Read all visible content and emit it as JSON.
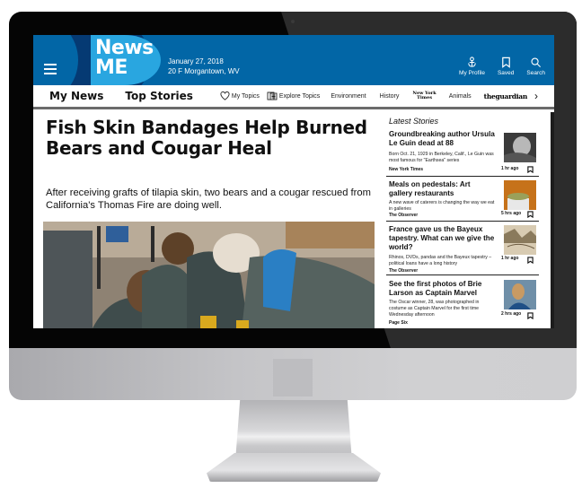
{
  "app": {
    "logo_line1": "News",
    "logo_line2": "ME",
    "date": "January 27, 2018",
    "weather_location": "20 F Morgantown, WV",
    "colors": {
      "primary": "#0266a6",
      "logo": "#29a6e0",
      "accent_dark": "#053a73"
    }
  },
  "top_actions": [
    {
      "label": "My Profile",
      "icon": "profile-icon"
    },
    {
      "label": "Saved",
      "icon": "bookmark-icon"
    },
    {
      "label": "Search",
      "icon": "search-icon"
    }
  ],
  "nav": {
    "primary": [
      "My News",
      "Top Stories"
    ],
    "my_topics": "My Topics",
    "explore_topics": "Explore Topics",
    "topics": [
      "Environment",
      "History"
    ],
    "nyt_line1": "New York",
    "nyt_line2": "Times",
    "animals": "Animals",
    "guardian": "theguardian",
    "next": "›"
  },
  "main_article": {
    "headline": "Fish Skin Bandages Help Burned Bears and Cougar Heal",
    "subhead": "After receiving grafts of tilapia skin, two bears and a cougar rescued from California's Thomas Fire are doing well."
  },
  "sidebar": {
    "title": "Latest Stories",
    "stories": [
      {
        "title": "Groundbreaking author Ursula Le Guin dead at 88",
        "description": "Born Oct. 21, 1929 in Berkeley, Calif., Le Guin was most famous for \"Earthsea\" series",
        "source": "New York Times",
        "time": "1 hr ago"
      },
      {
        "title": "Meals on pedestals: Art gallery restaurants",
        "description": "A new wave of caterers is changing the way we eat in galleries",
        "source": "The Observer",
        "time": "5 hrs ago"
      },
      {
        "title": "France gave us the Bayeux tapestry. What can we give the world?",
        "description": "Rhinos, DVDs, pandas and the Bayeux tapestry – political loans have a long history",
        "source": "The Observer",
        "time": "1 hr ago"
      },
      {
        "title": "See the first photos of Brie Larson as Captain Marvel",
        "description": "The Oscar winner, 28, was photographed in costume as Captain Marvel for the first time Wednesday afternoon",
        "source": "Page Six",
        "time": "2 hrs ago"
      }
    ]
  }
}
